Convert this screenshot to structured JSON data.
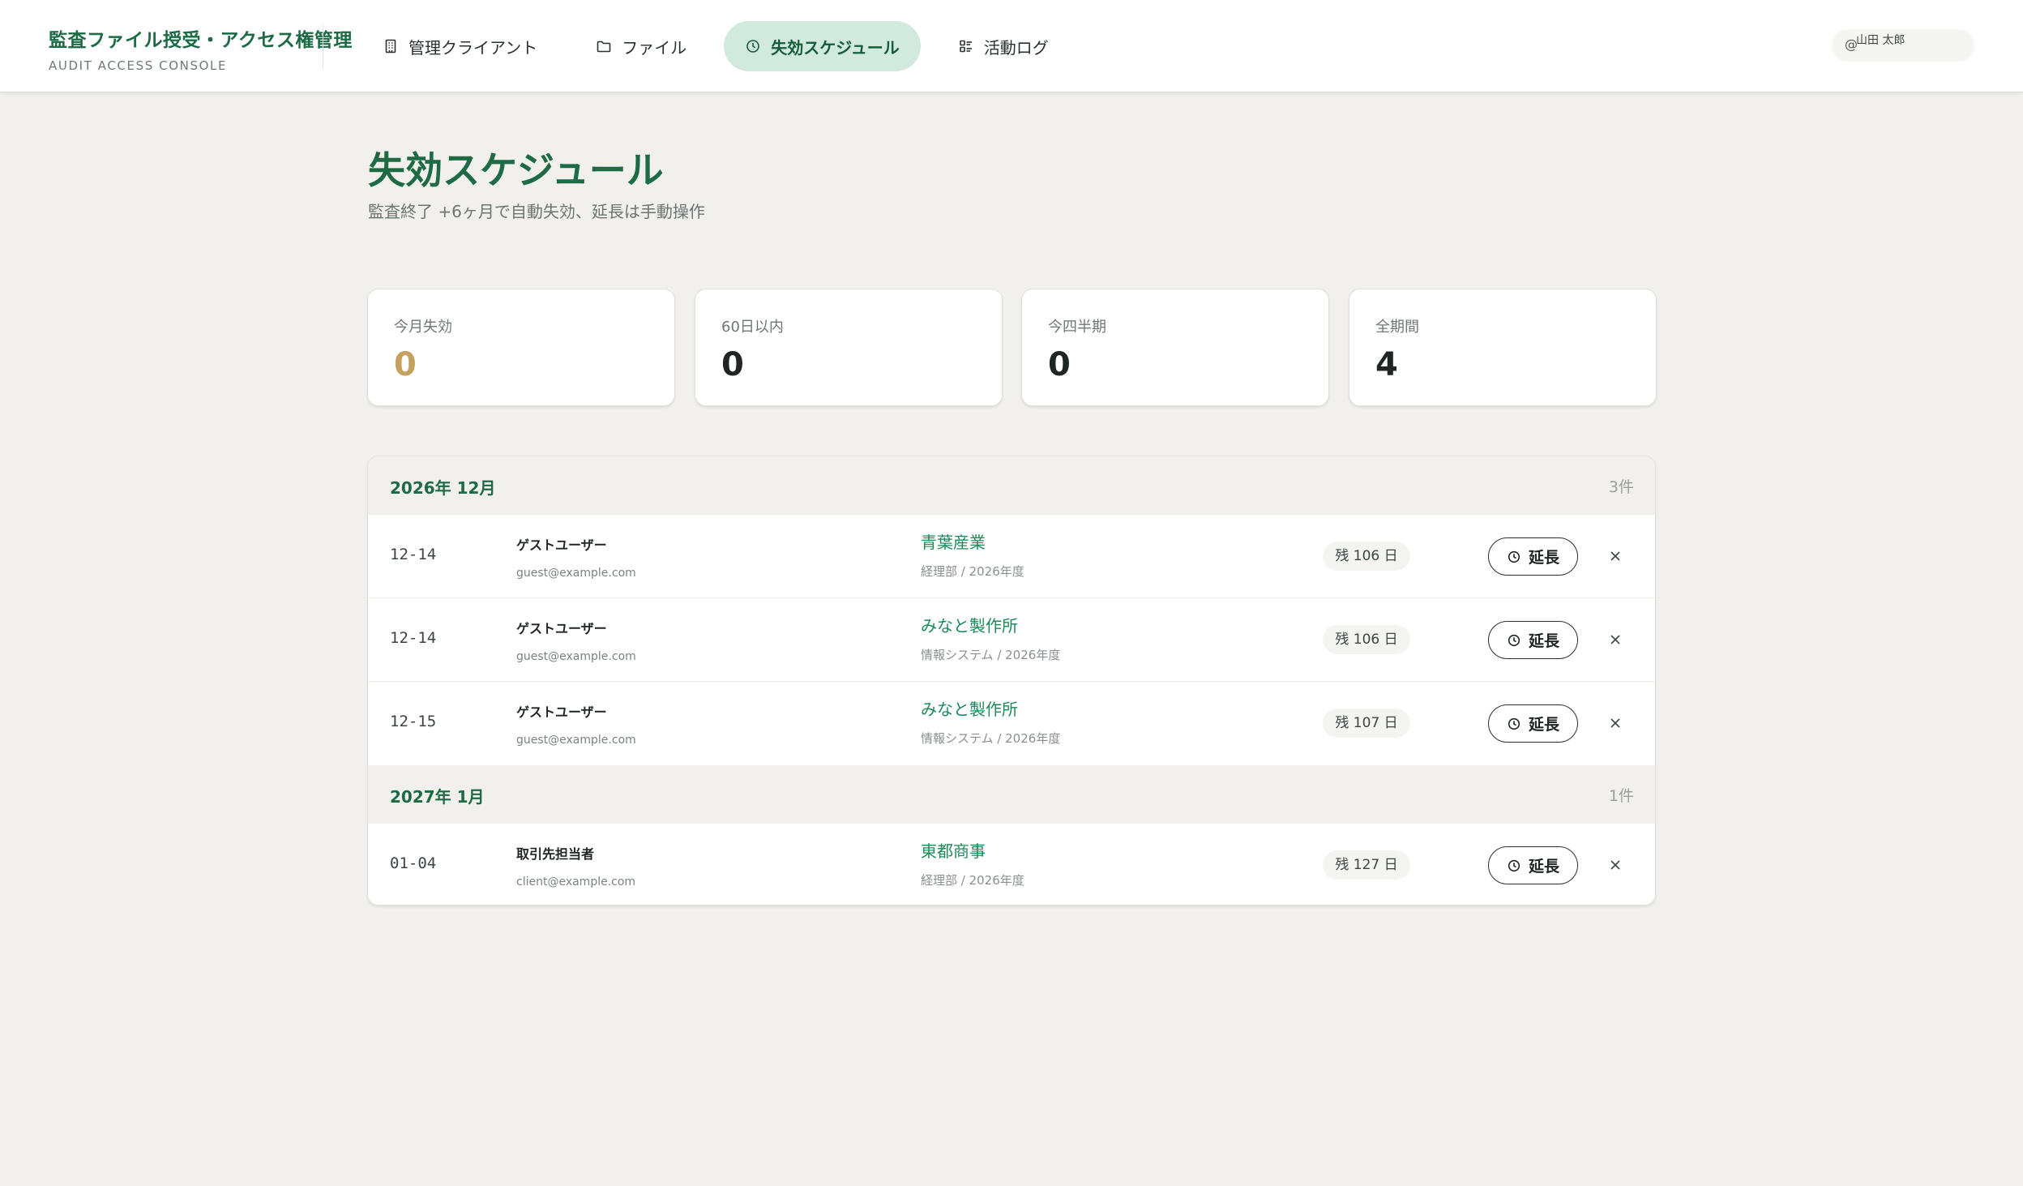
{
  "app": {
    "title": "監査ファイル授受・アクセス権管理",
    "subtitle": "AUDIT ACCESS CONSOLE"
  },
  "nav": {
    "items": [
      {
        "label": "管理クライアント",
        "icon": "building-icon"
      },
      {
        "label": "ファイル",
        "icon": "folder-icon"
      },
      {
        "label": "失効スケジュール",
        "icon": "clock-icon",
        "active": true
      },
      {
        "label": "活動ログ",
        "icon": "activity-list-icon"
      }
    ]
  },
  "user": {
    "prefix": "@",
    "name": "山田 太郎"
  },
  "page": {
    "title": "失効スケジュール",
    "subtitle": "監査終了 +6ヶ月で自動失効、延長は手動操作"
  },
  "stats": [
    {
      "label": "今月失効",
      "value": "0"
    },
    {
      "label": "60日以内",
      "value": "0"
    },
    {
      "label": "今四半期",
      "value": "0"
    },
    {
      "label": "全期間",
      "value": "4"
    }
  ],
  "groups": [
    {
      "title": "2026年 12月",
      "count": "3件",
      "rows": [
        {
          "date": "12-14",
          "user": "ゲストユーザー",
          "email": "guest@example.com",
          "client": "青葉産業",
          "meta": "経理部 / 2026年度",
          "remaining": "残 106 日",
          "extend": "延長"
        },
        {
          "date": "12-14",
          "user": "ゲストユーザー",
          "email": "guest@example.com",
          "client": "みなと製作所",
          "meta": "情報システム / 2026年度",
          "remaining": "残 106 日",
          "extend": "延長"
        },
        {
          "date": "12-15",
          "user": "ゲストユーザー",
          "email": "guest@example.com",
          "client": "みなと製作所",
          "meta": "情報システム / 2026年度",
          "remaining": "残 107 日",
          "extend": "延長"
        }
      ]
    },
    {
      "title": "2027年 1月",
      "count": "1件",
      "rows": [
        {
          "date": "01-04",
          "user": "取引先担当者",
          "email": "client@example.com",
          "client": "東都商事",
          "meta": "経理部 / 2026年度",
          "remaining": "残 127 日",
          "extend": "延長"
        }
      ]
    }
  ],
  "colors": {
    "brand": "#1d6a45",
    "accent_link": "#1d8a5a",
    "active_nav_bg": "#d2e9dd",
    "warn_value": "#c4a15c",
    "page_bg": "#f1f0ec"
  }
}
